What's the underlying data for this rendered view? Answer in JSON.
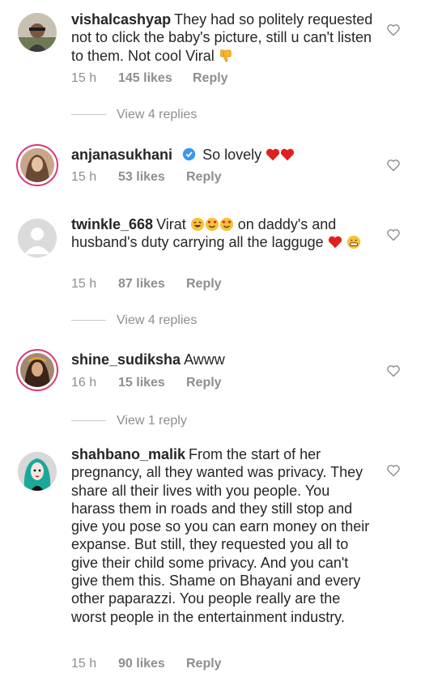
{
  "comments": [
    {
      "username": "vishalcashyap",
      "text": "They had so politely requested not to click the baby's picture, still u can't listen to them. Not cool Viral",
      "time": "15 h",
      "likes": "145 likes",
      "reply": "Reply"
    },
    {
      "username": "anjanasukhani",
      "text": "So lovely",
      "time": "15 h",
      "likes": "53 likes",
      "reply": "Reply"
    },
    {
      "username": "twinkle_668",
      "text_a": "Virat",
      "text_b": "on daddy's and husband's duty carrying all the lagguge",
      "time": "15 h",
      "likes": "87 likes",
      "reply": "Reply"
    },
    {
      "username": "shine_sudiksha",
      "text": "Awww",
      "time": "16 h",
      "likes": "15 likes",
      "reply": "Reply"
    },
    {
      "username": "shahbano_malik",
      "text": "From the start of her pregnancy, all they wanted was privacy. They share all their lives with you people. You harass them in roads and they still stop and give you pose so you can earn money on their expanse. But still, they requested you all to give their child some privacy. And you can't give them this. Shame on Bhayani and every other paparazzi. You people really are the worst people in the entertainment industry.",
      "time": "15 h",
      "likes": "90 likes",
      "reply": "Reply"
    }
  ],
  "view_replies": [
    "View 4 replies",
    "View 4 replies",
    "View 1 reply"
  ],
  "colors": {
    "meta": "#8e8e8e",
    "story_ring": "#d93778",
    "heart_red": "#e0201c",
    "verified_blue": "#3897f0"
  },
  "icons": {
    "like": "heart-outline-icon",
    "verified": "verified-badge-icon"
  }
}
